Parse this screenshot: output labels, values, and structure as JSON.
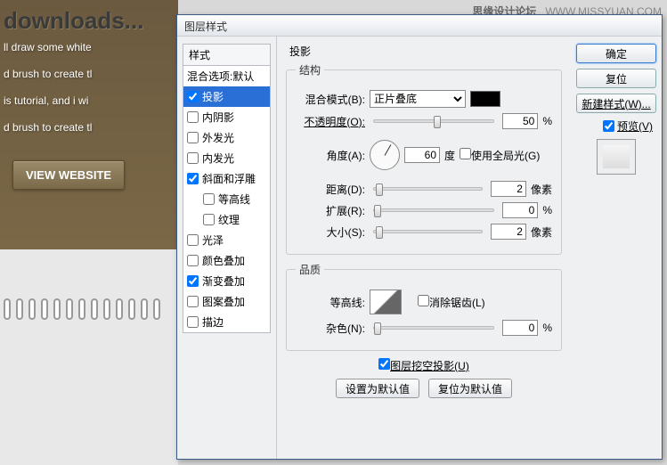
{
  "watermark": {
    "site": "思缘设计论坛",
    "url": "WWW.MISSYUAN.COM"
  },
  "background": {
    "heading": "downloads...",
    "lines": [
      "ll draw some white",
      "d brush to create tl",
      "is tutorial, and i wi",
      "d brush to create tl"
    ],
    "view_btn": "VIEW WEBSITE"
  },
  "dialog": {
    "title": "图层样式",
    "styles_header": "样式",
    "styles": [
      {
        "label": "混合选项:默认",
        "checked": false,
        "nocb": true
      },
      {
        "label": "投影",
        "checked": true,
        "sel": true
      },
      {
        "label": "内阴影",
        "checked": false
      },
      {
        "label": "外发光",
        "checked": false
      },
      {
        "label": "内发光",
        "checked": false
      },
      {
        "label": "斜面和浮雕",
        "checked": true
      },
      {
        "label": "等高线",
        "checked": false,
        "indent": true
      },
      {
        "label": "纹理",
        "checked": false,
        "indent": true
      },
      {
        "label": "光泽",
        "checked": false
      },
      {
        "label": "颜色叠加",
        "checked": false
      },
      {
        "label": "渐变叠加",
        "checked": true
      },
      {
        "label": "图案叠加",
        "checked": false
      },
      {
        "label": "描边",
        "checked": false
      }
    ],
    "mid": {
      "section_title": "投影",
      "structure_legend": "结构",
      "blend_label": "混合模式(B):",
      "blend_value": "正片叠底",
      "opacity_label": "不透明度(O):",
      "opacity_value": "50",
      "opacity_unit": "%",
      "angle_label": "角度(A):",
      "angle_value": "60",
      "angle_unit": "度",
      "global_light": "使用全局光(G)",
      "distance_label": "距离(D):",
      "distance_value": "2",
      "distance_unit": "像素",
      "spread_label": "扩展(R):",
      "spread_value": "0",
      "spread_unit": "%",
      "size_label": "大小(S):",
      "size_value": "2",
      "size_unit": "像素",
      "quality_legend": "品质",
      "contour_label": "等高线:",
      "antialias": "消除锯齿(L)",
      "noise_label": "杂色(N):",
      "noise_value": "0",
      "noise_unit": "%",
      "knockout": "图层挖空投影(U)",
      "set_default": "设置为默认值",
      "reset_default": "复位为默认值"
    },
    "right": {
      "ok": "确定",
      "cancel": "复位",
      "new_style": "新建样式(W)...",
      "preview": "预览(V)"
    }
  }
}
